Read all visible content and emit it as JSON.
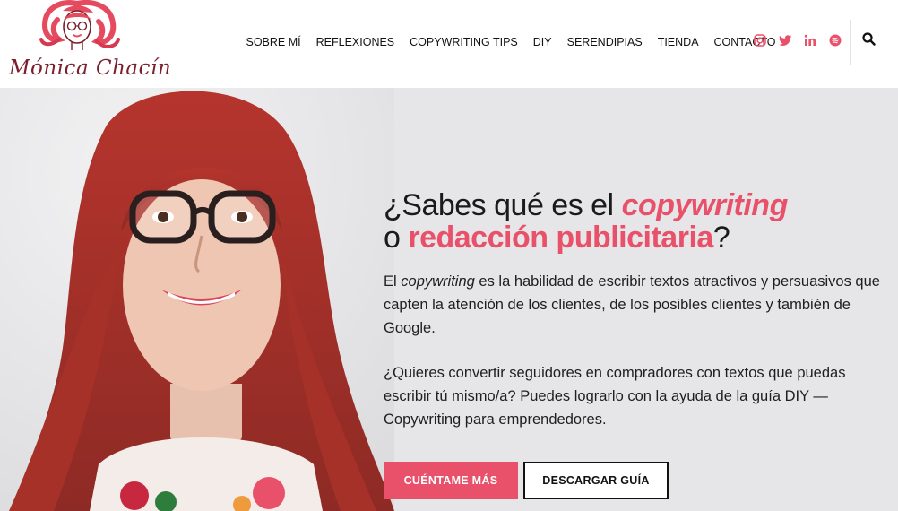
{
  "brand": {
    "name": "Mónica Chacín",
    "accent_color": "#e9516a",
    "logo_color": "#7a1f2b"
  },
  "nav": {
    "items": [
      "SOBRE MÍ",
      "REFLEXIONES",
      "COPYWRITING TIPS",
      "DIY",
      "SERENDIPIAS",
      "TIENDA",
      "CONTACTO"
    ]
  },
  "social": {
    "icons": [
      "instagram-icon",
      "twitter-icon",
      "linkedin-icon",
      "spotify-icon"
    ]
  },
  "search": {
    "icon": "search-icon"
  },
  "hero": {
    "title_part1": "¿Sabes qué es el ",
    "title_accent1": "copywriting",
    "title_part2": "o ",
    "title_accent2": "redacción publicitaria",
    "title_part3": "?",
    "p1_prefix": "El ",
    "p1_em": "copywriting",
    "p1_rest": " es la habilidad de escribir textos atractivos y persuasivos que capten la atención de los clientes, de los posibles clientes y también de Google.",
    "p2": "¿Quieres convertir seguidores en compradores con textos que puedas escribir tú mismo/a? Puedes lograrlo con la ayuda de la guía DIY — Copywriting para emprendedores.",
    "btn_primary": "CUÉNTAME MÁS",
    "btn_secondary": "DESCARGAR GUÍA"
  }
}
